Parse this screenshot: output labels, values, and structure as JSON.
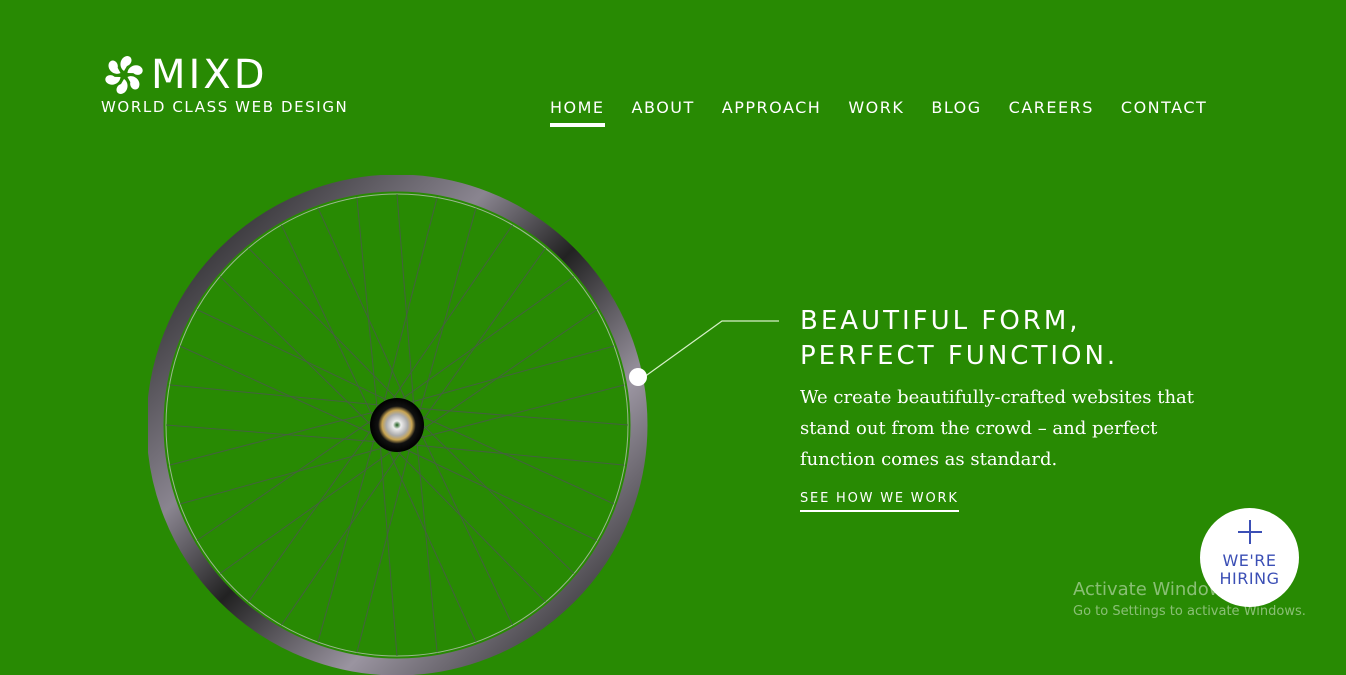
{
  "brand": {
    "name": "MIXD",
    "tagline": "WORLD CLASS WEB DESIGN",
    "logo_icon": "pinwheel-icon"
  },
  "nav": {
    "items": [
      {
        "label": "HOME",
        "active": true
      },
      {
        "label": "ABOUT",
        "active": false
      },
      {
        "label": "APPROACH",
        "active": false
      },
      {
        "label": "WORK",
        "active": false
      },
      {
        "label": "BLOG",
        "active": false
      },
      {
        "label": "CAREERS",
        "active": false
      },
      {
        "label": "CONTACT",
        "active": false
      }
    ]
  },
  "hero": {
    "title_line1": "BEAUTIFUL FORM,",
    "title_line2": "PERFECT FUNCTION.",
    "body": "We create beautifully-crafted websites that stand out from the crowd – and perfect function comes as standard.",
    "cta_label": "SEE HOW WE WORK",
    "image": "bicycle-wheel"
  },
  "hiring_badge": {
    "icon": "plus-icon",
    "line1": "WE'RE",
    "line2": "HIRING"
  },
  "windows_watermark": {
    "title": "Activate Windows",
    "subtitle": "Go to Settings to activate Windows."
  },
  "colors": {
    "background": "#288a03",
    "text": "#ffffff",
    "hiring_text": "#3b4fb5"
  }
}
